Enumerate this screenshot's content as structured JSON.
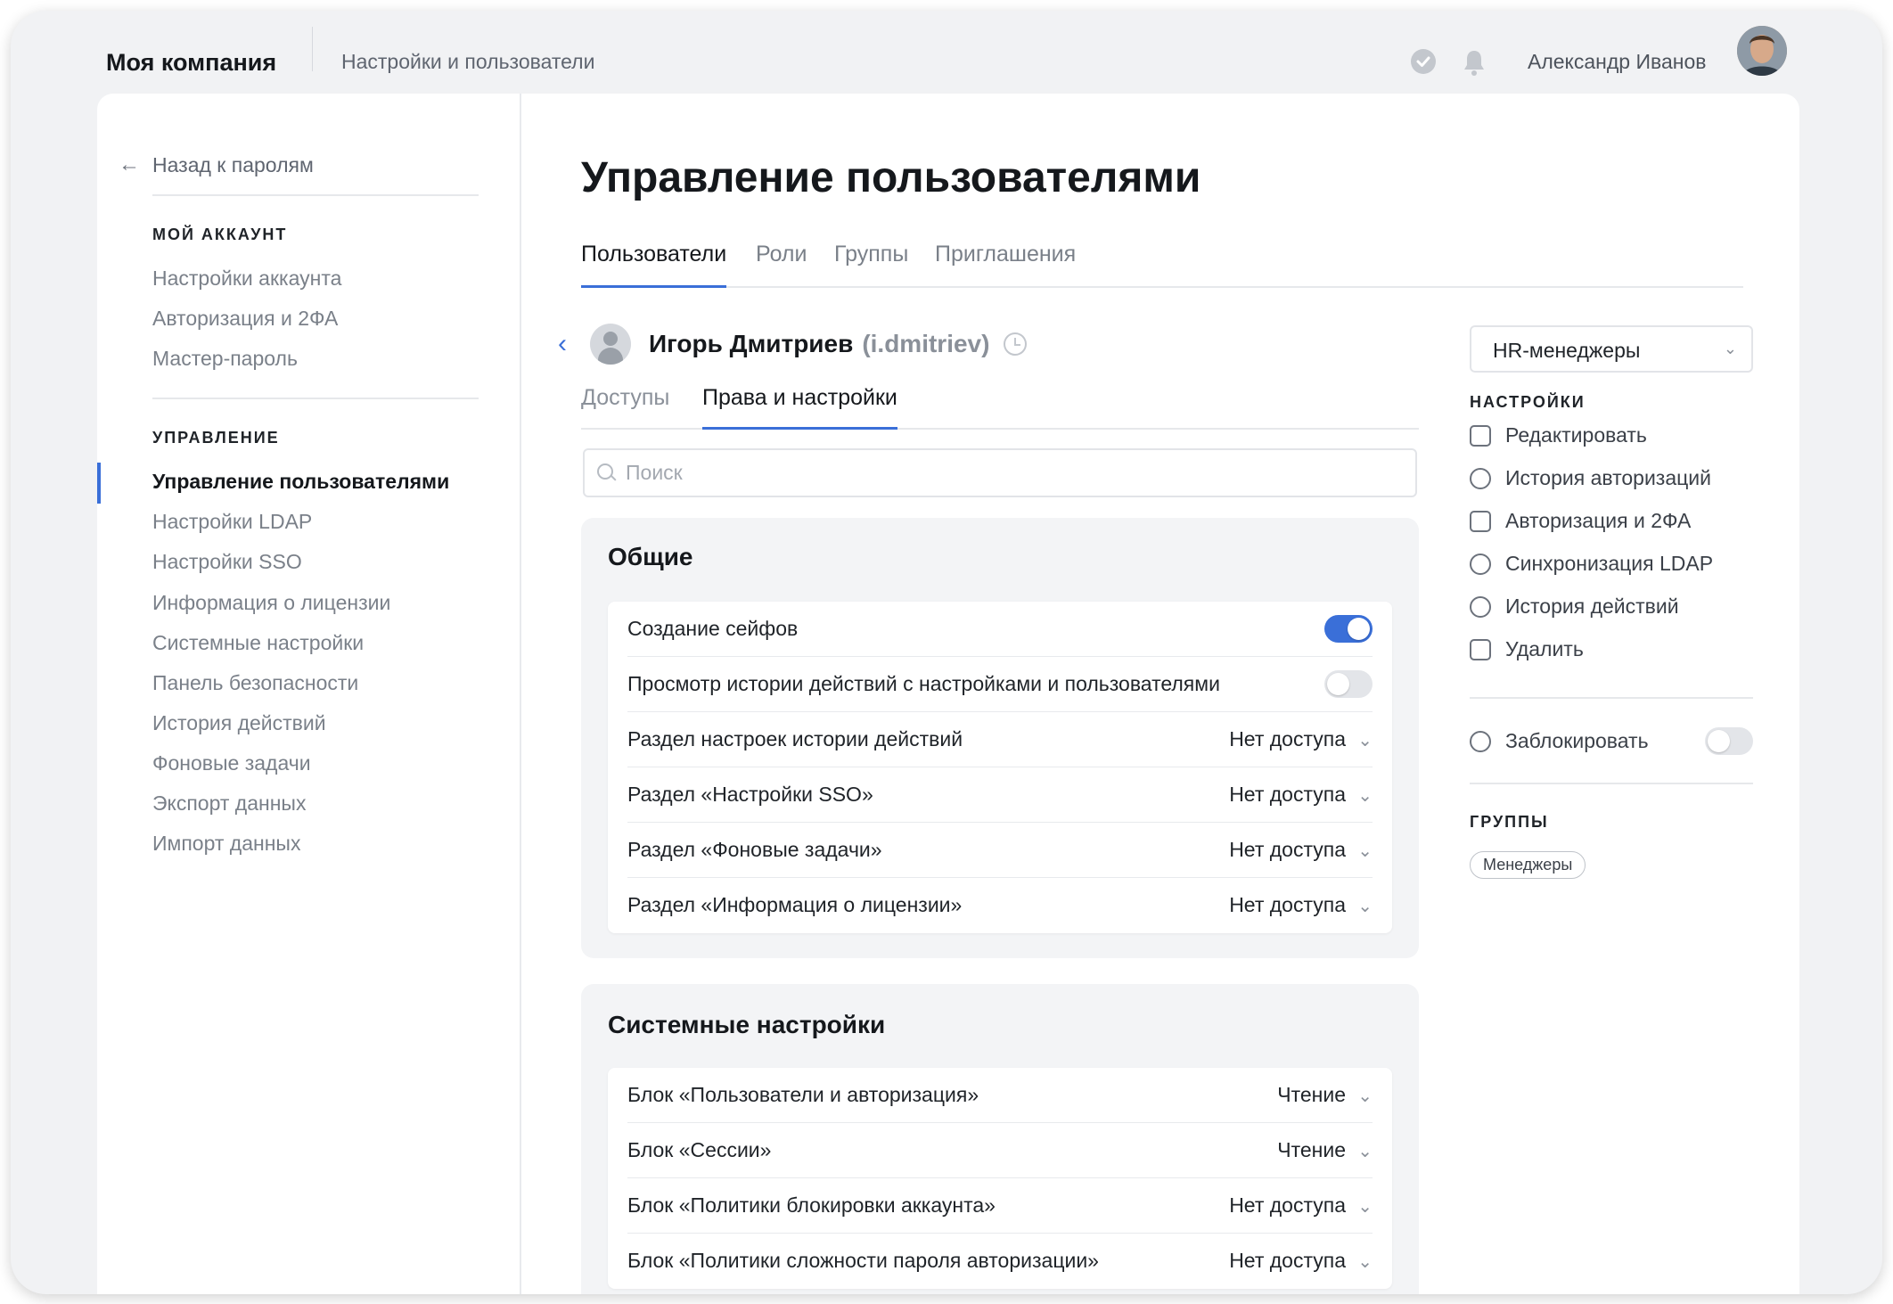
{
  "header": {
    "company": "Моя компания",
    "section": "Настройки и пользователи",
    "user_name": "Александр Иванов"
  },
  "sidebar": {
    "back_label": "Назад к паролям",
    "account_heading": "МОЙ АККАУНТ",
    "account_items": [
      "Настройки аккаунта",
      "Авторизация и 2ФА",
      "Мастер-пароль"
    ],
    "management_heading": "УПРАВЛЕНИЕ",
    "management_items": [
      "Управление пользователями",
      "Настройки LDAP",
      "Настройки SSO",
      "Информация о лицензии",
      "Системные настройки",
      "Панель безопасности",
      "История действий",
      "Фоновые задачи",
      "Экспорт данных",
      "Импорт данных"
    ]
  },
  "main": {
    "title": "Управление пользователями",
    "tabs": [
      "Пользователи",
      "Роли",
      "Группы",
      "Приглашения"
    ],
    "user": {
      "name": "Игорь Дмитриев",
      "login": "(i.dmitriev)"
    },
    "subtabs": [
      "Доступы",
      "Права и настройки"
    ],
    "search_placeholder": "Поиск",
    "groups": [
      {
        "title": "Общие",
        "rows": [
          {
            "label": "Создание сейфов",
            "toggle": true
          },
          {
            "label": "Просмотр истории действий с настройками и пользователями",
            "toggle": false
          },
          {
            "label": "Раздел настроек истории действий",
            "value": "Нет доступа"
          },
          {
            "label": "Раздел «Настройки SSO»",
            "value": "Нет доступа"
          },
          {
            "label": "Раздел «Фоновые задачи»",
            "value": "Нет доступа"
          },
          {
            "label": "Раздел «Информация о лицензии»",
            "value": "Нет доступа"
          }
        ]
      },
      {
        "title": "Системные настройки",
        "rows": [
          {
            "label": "Блок «Пользователи и авторизация»",
            "value": "Чтение"
          },
          {
            "label": "Блок «Сессии»",
            "value": "Чтение"
          },
          {
            "label": "Блок «Политики блокировки аккаунта»",
            "value": "Нет доступа"
          },
          {
            "label": "Блок «Политики сложности пароля авторизации»",
            "value": "Нет доступа"
          }
        ]
      }
    ]
  },
  "right_panel": {
    "role": "HR-менеджеры",
    "settings_heading": "НАСТРОЙКИ",
    "actions": [
      "Редактировать",
      "История авторизаций",
      "Авторизация и 2ФА",
      "Синхронизация LDAP",
      "История действий",
      "Удалить"
    ],
    "block_label": "Заблокировать",
    "block_enabled": false,
    "groups_heading": "ГРУППЫ",
    "groups": [
      "Менеджеры"
    ]
  },
  "colors": {
    "accent": "#3a6fd8",
    "muted": "#7a8089",
    "text": "#1f2328"
  }
}
